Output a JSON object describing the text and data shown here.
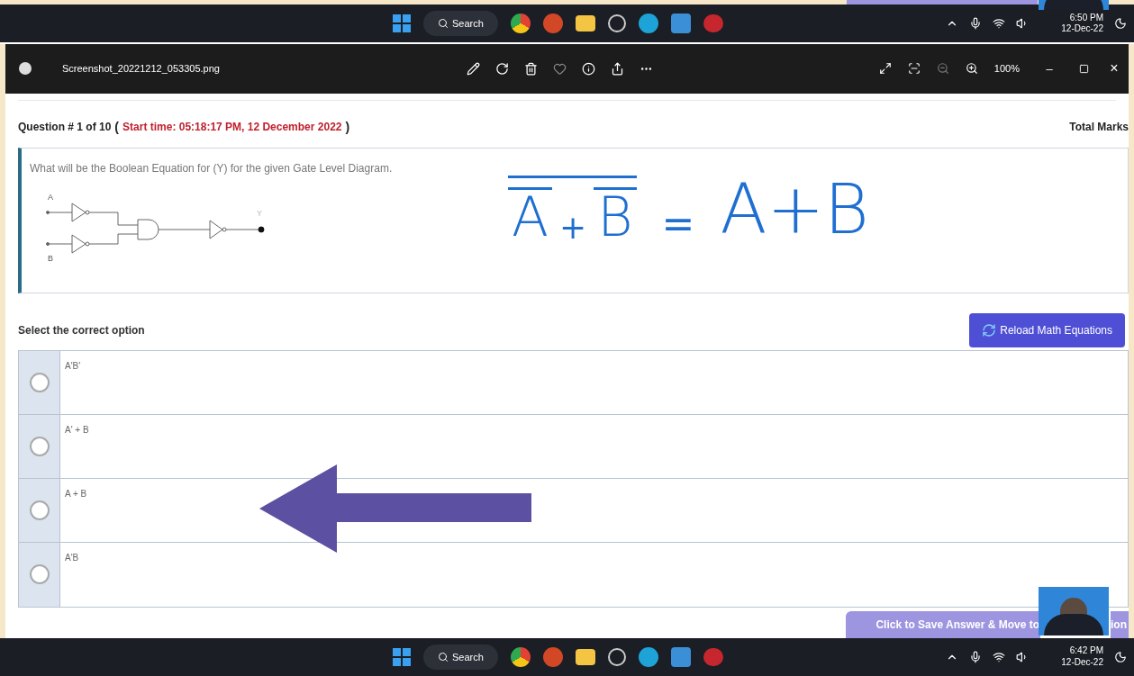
{
  "taskbar_top": {
    "search": "Search",
    "time": "6:50 PM",
    "date": "12-Dec-22"
  },
  "viewer": {
    "filename": "Screenshot_20221212_053305.png",
    "zoom": "100%",
    "minimize": "–",
    "close": "×"
  },
  "question": {
    "heading": "Question # 1 of 10",
    "paren_open": "(",
    "start_time": "Start time: 05:18:17 PM, 12 December 2022",
    "paren_close": ")",
    "total_marks": "Total Marks",
    "text": "What will be the Boolean Equation for (Y) for the given Gate Level Diagram.",
    "diagram_labels": [
      "A",
      "B",
      "Y"
    ]
  },
  "annotation": {
    "left": [
      "A",
      "+",
      "B"
    ],
    "equals": "=",
    "right": "A+B"
  },
  "select_prompt": "Select the correct option",
  "reload_button": "Reload Math Equations",
  "options": [
    {
      "label": "A'B'",
      "selected": false
    },
    {
      "label": "A' + B",
      "selected": false
    },
    {
      "label": "A + B",
      "selected": false
    },
    {
      "label": "A'B",
      "selected": false
    }
  ],
  "save_button": {
    "visible_start": "Click to Save Answer & Move to",
    "visible_end": "ion"
  },
  "taskbar_bottom": {
    "search": "Search",
    "time": "6:42 PM",
    "date": "12-Dec-22"
  }
}
